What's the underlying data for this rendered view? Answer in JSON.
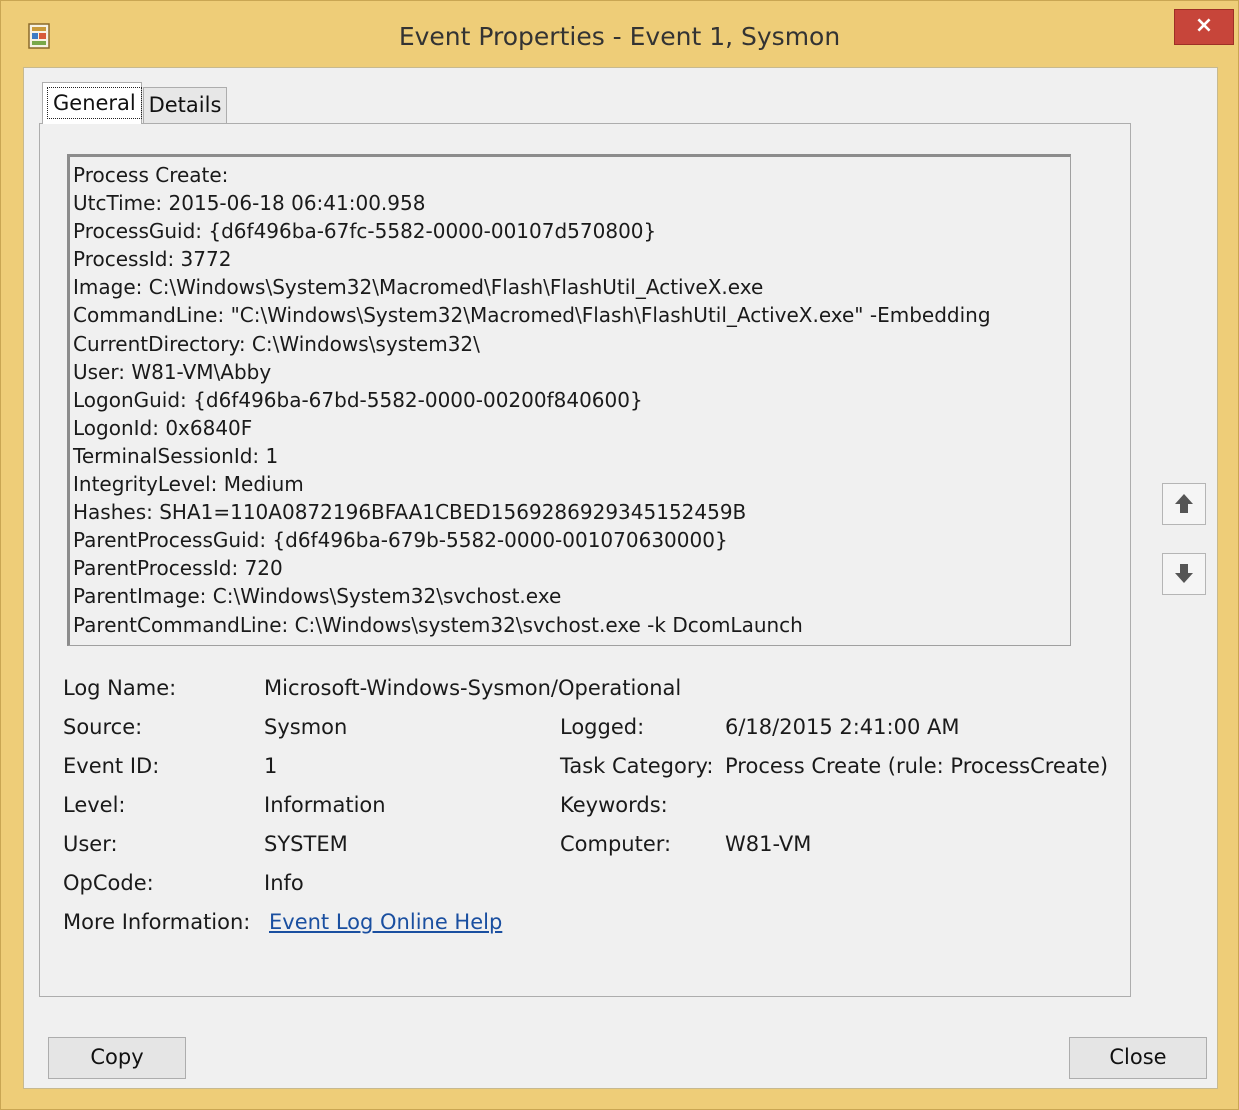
{
  "window": {
    "title": "Event Properties - Event 1, Sysmon",
    "close_glyph": "×"
  },
  "tabs": [
    {
      "label": "General",
      "selected": true
    },
    {
      "label": "Details",
      "selected": false
    }
  ],
  "event_description": [
    "Process Create:",
    "UtcTime: 2015-06-18 06:41:00.958",
    "ProcessGuid: {d6f496ba-67fc-5582-0000-00107d570800}",
    "ProcessId: 3772",
    "Image: C:\\Windows\\System32\\Macromed\\Flash\\FlashUtil_ActiveX.exe",
    "CommandLine: \"C:\\Windows\\System32\\Macromed\\Flash\\FlashUtil_ActiveX.exe\" -Embedding",
    "CurrentDirectory: C:\\Windows\\system32\\",
    "User: W81-VM\\Abby",
    "LogonGuid: {d6f496ba-67bd-5582-0000-00200f840600}",
    "LogonId: 0x6840F",
    "TerminalSessionId: 1",
    "IntegrityLevel: Medium",
    "Hashes: SHA1=110A0872196BFAA1CBED1569286929345152459B",
    "ParentProcessGuid: {d6f496ba-679b-5582-0000-001070630000}",
    "ParentProcessId: 720",
    "ParentImage: C:\\Windows\\System32\\svchost.exe",
    "ParentCommandLine: C:\\Windows\\system32\\svchost.exe -k DcomLaunch"
  ],
  "fields": {
    "log_name": {
      "label": "Log Name:",
      "value": "Microsoft-Windows-Sysmon/Operational"
    },
    "source": {
      "label": "Source:",
      "value": "Sysmon"
    },
    "logged": {
      "label": "Logged:",
      "value": "6/18/2015 2:41:00 AM"
    },
    "event_id": {
      "label": "Event ID:",
      "value": "1"
    },
    "task_category": {
      "label": "Task Category:",
      "value": "Process Create (rule: ProcessCreate)"
    },
    "level": {
      "label": "Level:",
      "value": "Information"
    },
    "keywords": {
      "label": "Keywords:",
      "value": ""
    },
    "user": {
      "label": "User:",
      "value": "SYSTEM"
    },
    "computer": {
      "label": "Computer:",
      "value": "W81-VM"
    },
    "opcode": {
      "label": "OpCode:",
      "value": "Info"
    },
    "more_information": {
      "label": "More Information:",
      "value": "Event Log Online Help"
    }
  },
  "buttons": {
    "copy": "Copy",
    "close": "Close"
  },
  "icons": {
    "app": "event-viewer-icon",
    "up": "arrow-up-icon",
    "down": "arrow-down-icon"
  },
  "colors": {
    "frame": "#eecd78",
    "close_button": "#c7453a",
    "link": "#1a4fa0"
  }
}
